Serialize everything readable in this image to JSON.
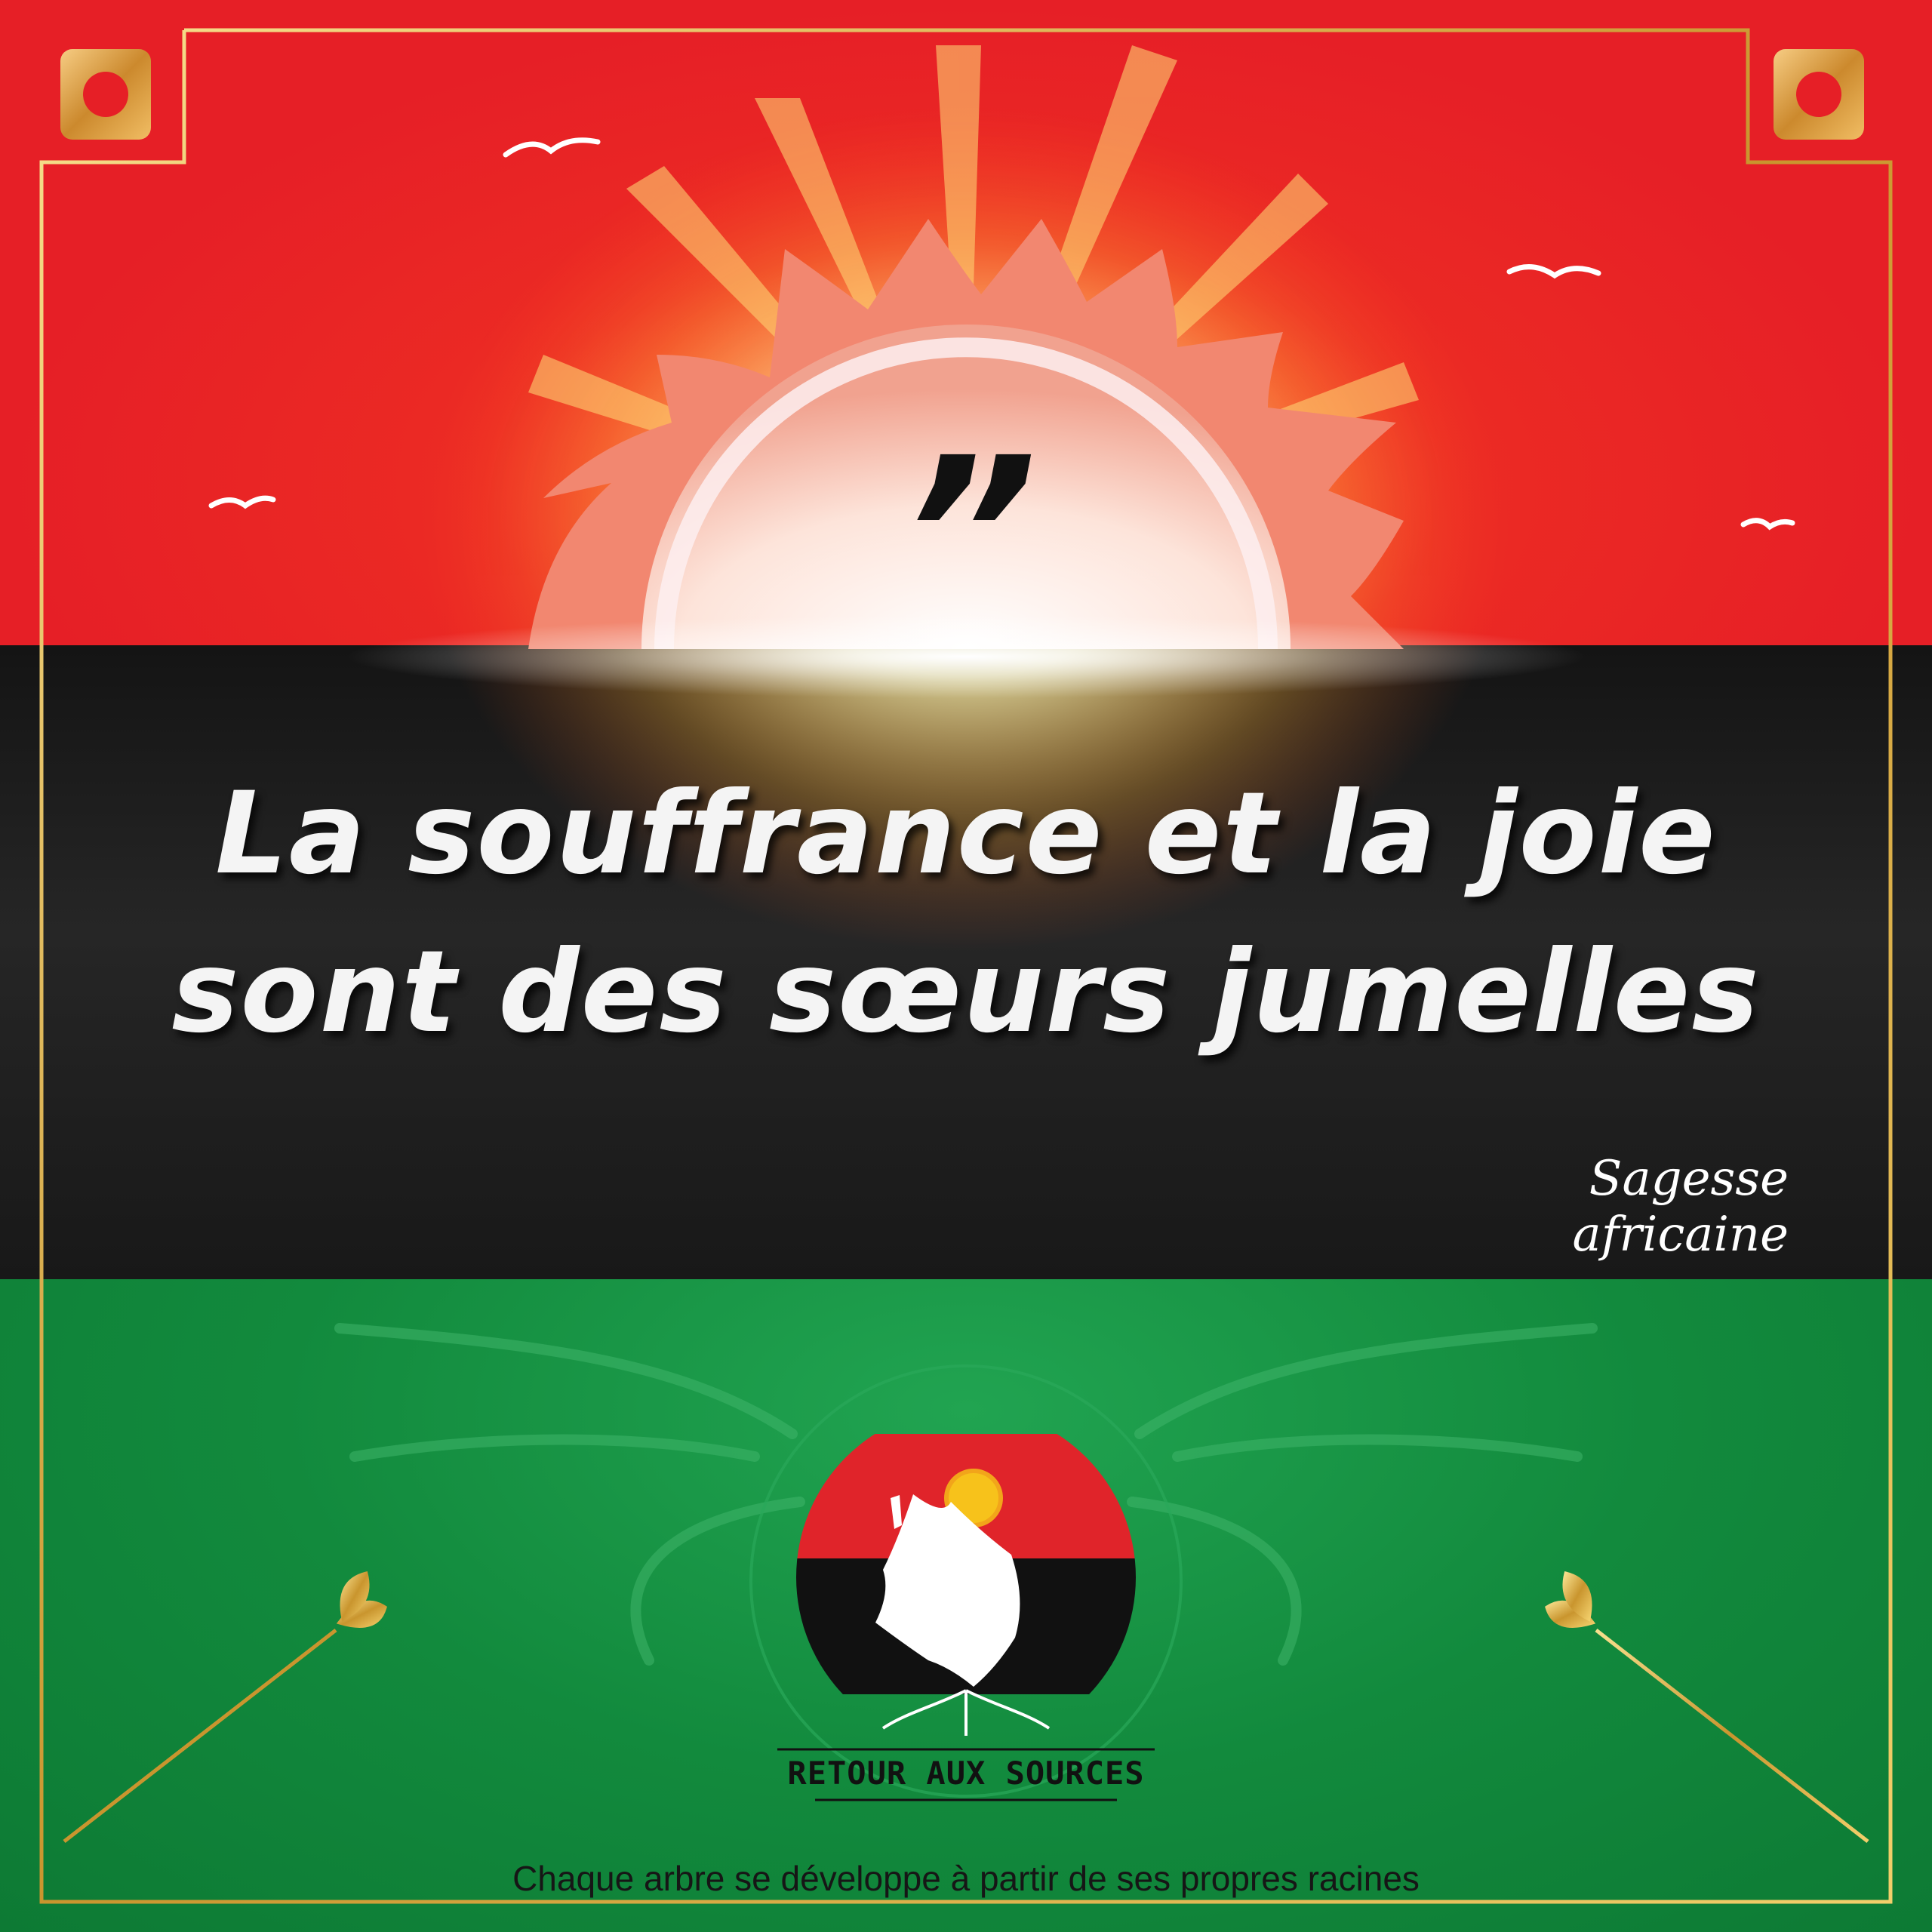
{
  "quote": {
    "mark": "”",
    "line1": "La souffrance et la joie",
    "line2": "sont des sœurs jumelles",
    "attribution": "Sagesse africaine"
  },
  "brand": {
    "name": "RETOUR AUX SOURCES",
    "tagline": "Chaque arbre se développe à partir de ses propres racines"
  },
  "colors": {
    "red": "#e61f26",
    "black": "#1c1c1c",
    "green": "#128a3d",
    "gold": "#d9a93c",
    "sun": "#f7c21b"
  }
}
